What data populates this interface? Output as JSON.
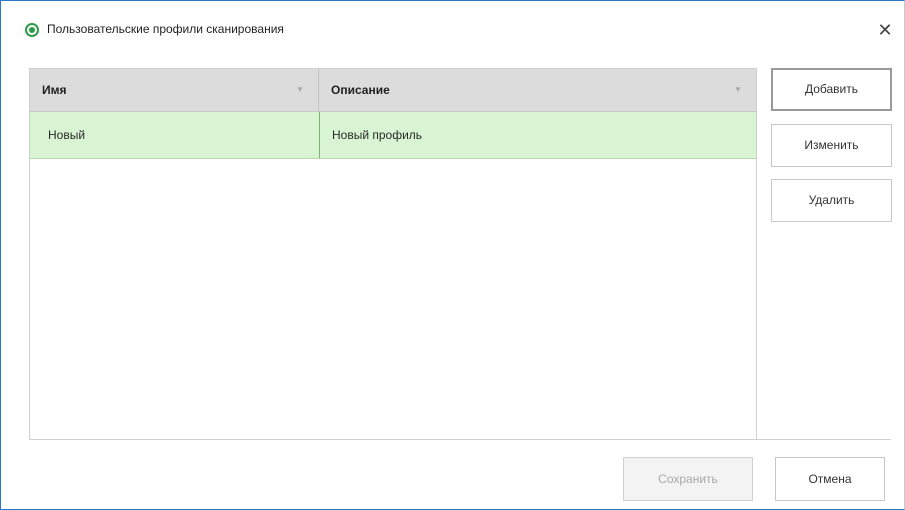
{
  "window": {
    "title": "Пользовательские профили сканирования",
    "close_glyph": "✕"
  },
  "grid": {
    "columns": [
      {
        "label": "Имя",
        "sort_icon": "sort-icon"
      },
      {
        "label": "Описание",
        "sort_icon": "sort-icon"
      }
    ],
    "rows": [
      {
        "name": "Новый",
        "description": "Новый профиль",
        "selected": true
      }
    ]
  },
  "side_buttons": {
    "add_label": "Добавить",
    "edit_label": "Изменить",
    "delete_label": "Удалить"
  },
  "footer": {
    "save_label": "Сохранить",
    "save_enabled": false,
    "cancel_label": "Отмена"
  },
  "colors": {
    "selected_row": "#d9f4d2",
    "header_bg": "#dcdcdc",
    "app_icon": "#2f9b4a"
  }
}
